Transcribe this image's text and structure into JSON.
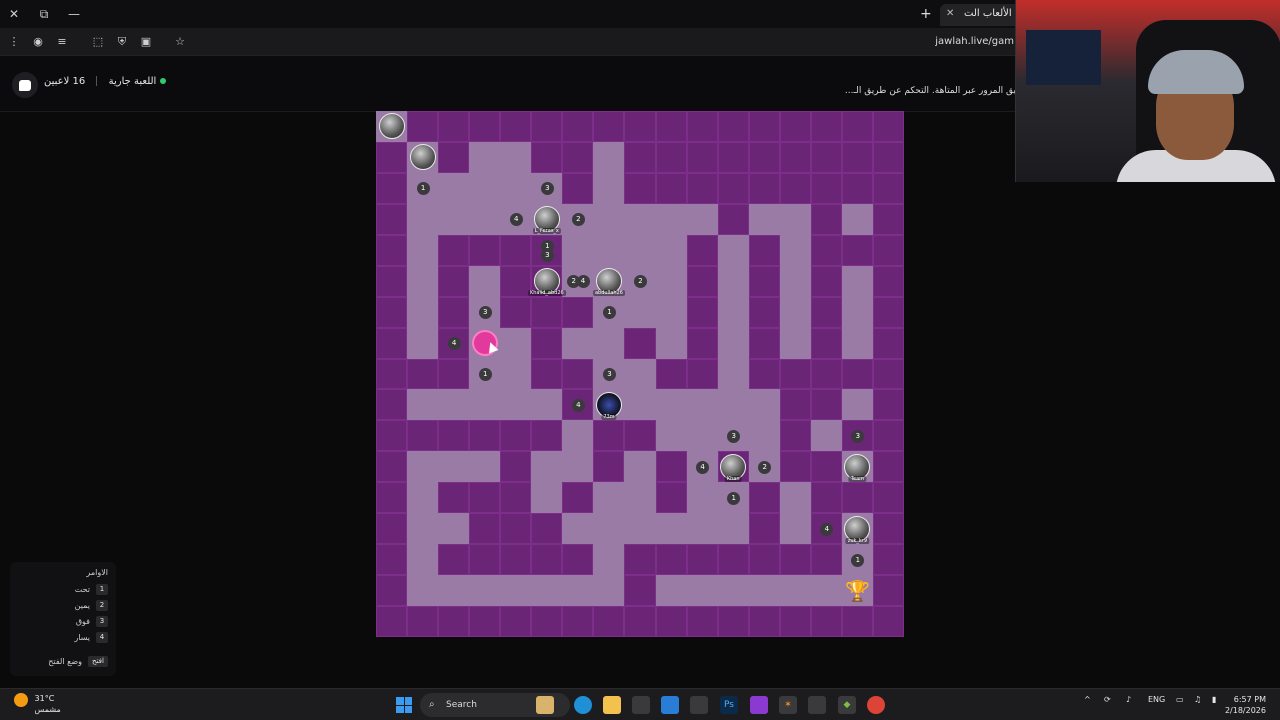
{
  "browser": {
    "tab_title": "منصة الألعاب الت...",
    "address": "jawlah.live/gam",
    "icons": [
      "close-window-icon",
      "restore-icon",
      "minimize-icon",
      "menu-dots-icon",
      "extension-icon",
      "reading-list-icon",
      "puzzle-icon",
      "shield-icon",
      "twitch-icon",
      "star-icon"
    ]
  },
  "app": {
    "game_status": "اللعبة جارية",
    "players_count": "16 لاعبين",
    "instructions": "...يق المرور عبر المتاهة. التحكم عن طريق الـ"
  },
  "maze": {
    "players": [
      {
        "name": "",
        "r": 0,
        "c": 0
      },
      {
        "name": "",
        "r": 1,
        "c": 1
      },
      {
        "name": "L_Feras_x",
        "r": 3,
        "c": 5
      },
      {
        "name": "Khalid_abd26",
        "r": 5,
        "c": 5
      },
      {
        "name": "abdullah26",
        "r": 5,
        "c": 7
      },
      {
        "name": "",
        "r": 7,
        "c": 3,
        "self": true
      },
      {
        "name": "73m",
        "r": 9,
        "c": 7,
        "dark": true
      },
      {
        "name": "Khan",
        "r": 11,
        "c": 11
      },
      {
        "name": "Team",
        "r": 11,
        "c": 15
      },
      {
        "name": "zuk_kr9",
        "r": 13,
        "c": 15
      }
    ],
    "markers": [
      {
        "label": "1",
        "r": 2,
        "c": 1
      },
      {
        "label": "3",
        "r": 2,
        "c": 5
      },
      {
        "label": "4",
        "r": 3,
        "c": 4
      },
      {
        "label": "2",
        "r": 3,
        "c": 6
      },
      {
        "label": "1",
        "r": 3.85,
        "c": 5
      },
      {
        "label": "3",
        "r": 4.15,
        "c": 5
      },
      {
        "label": "2",
        "r": 5,
        "c": 5.85
      },
      {
        "label": "4",
        "r": 5,
        "c": 6.15
      },
      {
        "label": "2",
        "r": 5,
        "c": 8
      },
      {
        "label": "1",
        "r": 6,
        "c": 7
      },
      {
        "label": "3",
        "r": 6,
        "c": 3
      },
      {
        "label": "4",
        "r": 7,
        "c": 2
      },
      {
        "label": "1",
        "r": 8,
        "c": 3
      },
      {
        "label": "3",
        "r": 8,
        "c": 7
      },
      {
        "label": "4",
        "r": 9,
        "c": 6
      },
      {
        "label": "3",
        "r": 10,
        "c": 11
      },
      {
        "label": "3",
        "r": 10,
        "c": 15
      },
      {
        "label": "4",
        "r": 11,
        "c": 10
      },
      {
        "label": "2",
        "r": 11,
        "c": 12
      },
      {
        "label": "1",
        "r": 12,
        "c": 11
      },
      {
        "label": "4",
        "r": 13,
        "c": 14
      },
      {
        "label": "1",
        "r": 14,
        "c": 15
      }
    ],
    "goal": {
      "icon": "trophy-icon",
      "r": 15,
      "c": 15
    }
  },
  "commands": {
    "title": "الاوامر",
    "items": [
      {
        "key": "1",
        "label": "تحت"
      },
      {
        "key": "2",
        "label": "يمين"
      },
      {
        "key": "3",
        "label": "فوق"
      },
      {
        "key": "4",
        "label": "يسار"
      }
    ],
    "open_key": "افتح",
    "open_label": "وضع الفتح"
  },
  "taskbar": {
    "weather_temp": "31°C",
    "weather_desc": "مشمس",
    "search": "Search",
    "lang": "ENG",
    "time": "6:57 PM",
    "date": "2/18/2026"
  }
}
